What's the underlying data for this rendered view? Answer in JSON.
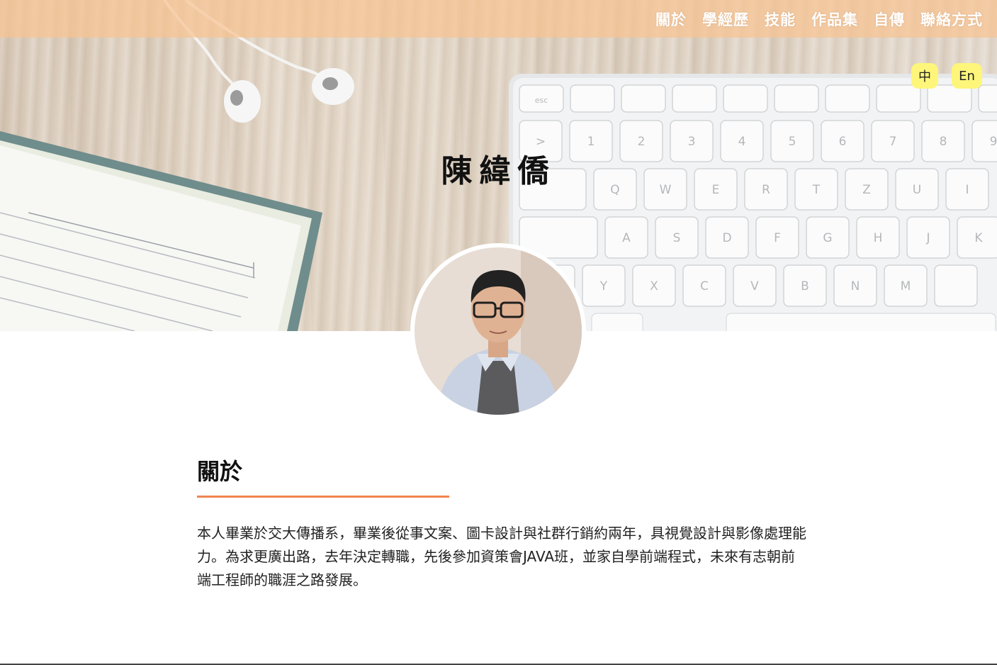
{
  "nav": {
    "items": [
      "關於",
      "學經歷",
      "技能",
      "作品集",
      "自傳",
      "聯絡方式"
    ]
  },
  "language": {
    "zh": "中",
    "en": "En"
  },
  "profile": {
    "name": "陳緯僑"
  },
  "about": {
    "title": "關於",
    "text": "本人畢業於交大傳播系，畢業後從事文案、圖卡設計與社群行銷約兩年，具視覺設計與影像處理能力。為求更廣出路，去年決定轉職，先後參加資策會JAVA班，並家自學前端程式，未來有志朝前端工程師的職涯之路發展。"
  },
  "keyboard": {
    "row1": [
      "esc",
      "",
      "",
      "",
      "",
      "",
      "",
      "",
      "",
      ""
    ],
    "row2": [
      ">",
      "1",
      "2",
      "3",
      "4",
      "5",
      "6",
      "7",
      "8",
      "9"
    ],
    "row3": [
      "",
      "Q",
      "W",
      "E",
      "R",
      "T",
      "Z",
      "U",
      "I"
    ],
    "row4": [
      "",
      "A",
      "S",
      "D",
      "F",
      "G",
      "H",
      "J",
      "K"
    ],
    "row5": [
      "",
      "Y",
      "X",
      "C",
      "V",
      "B",
      "N",
      "M",
      ""
    ]
  },
  "colors": {
    "accent": "#f0854f",
    "topbar": "#f8c492",
    "lang_button": "#fdf67a"
  }
}
